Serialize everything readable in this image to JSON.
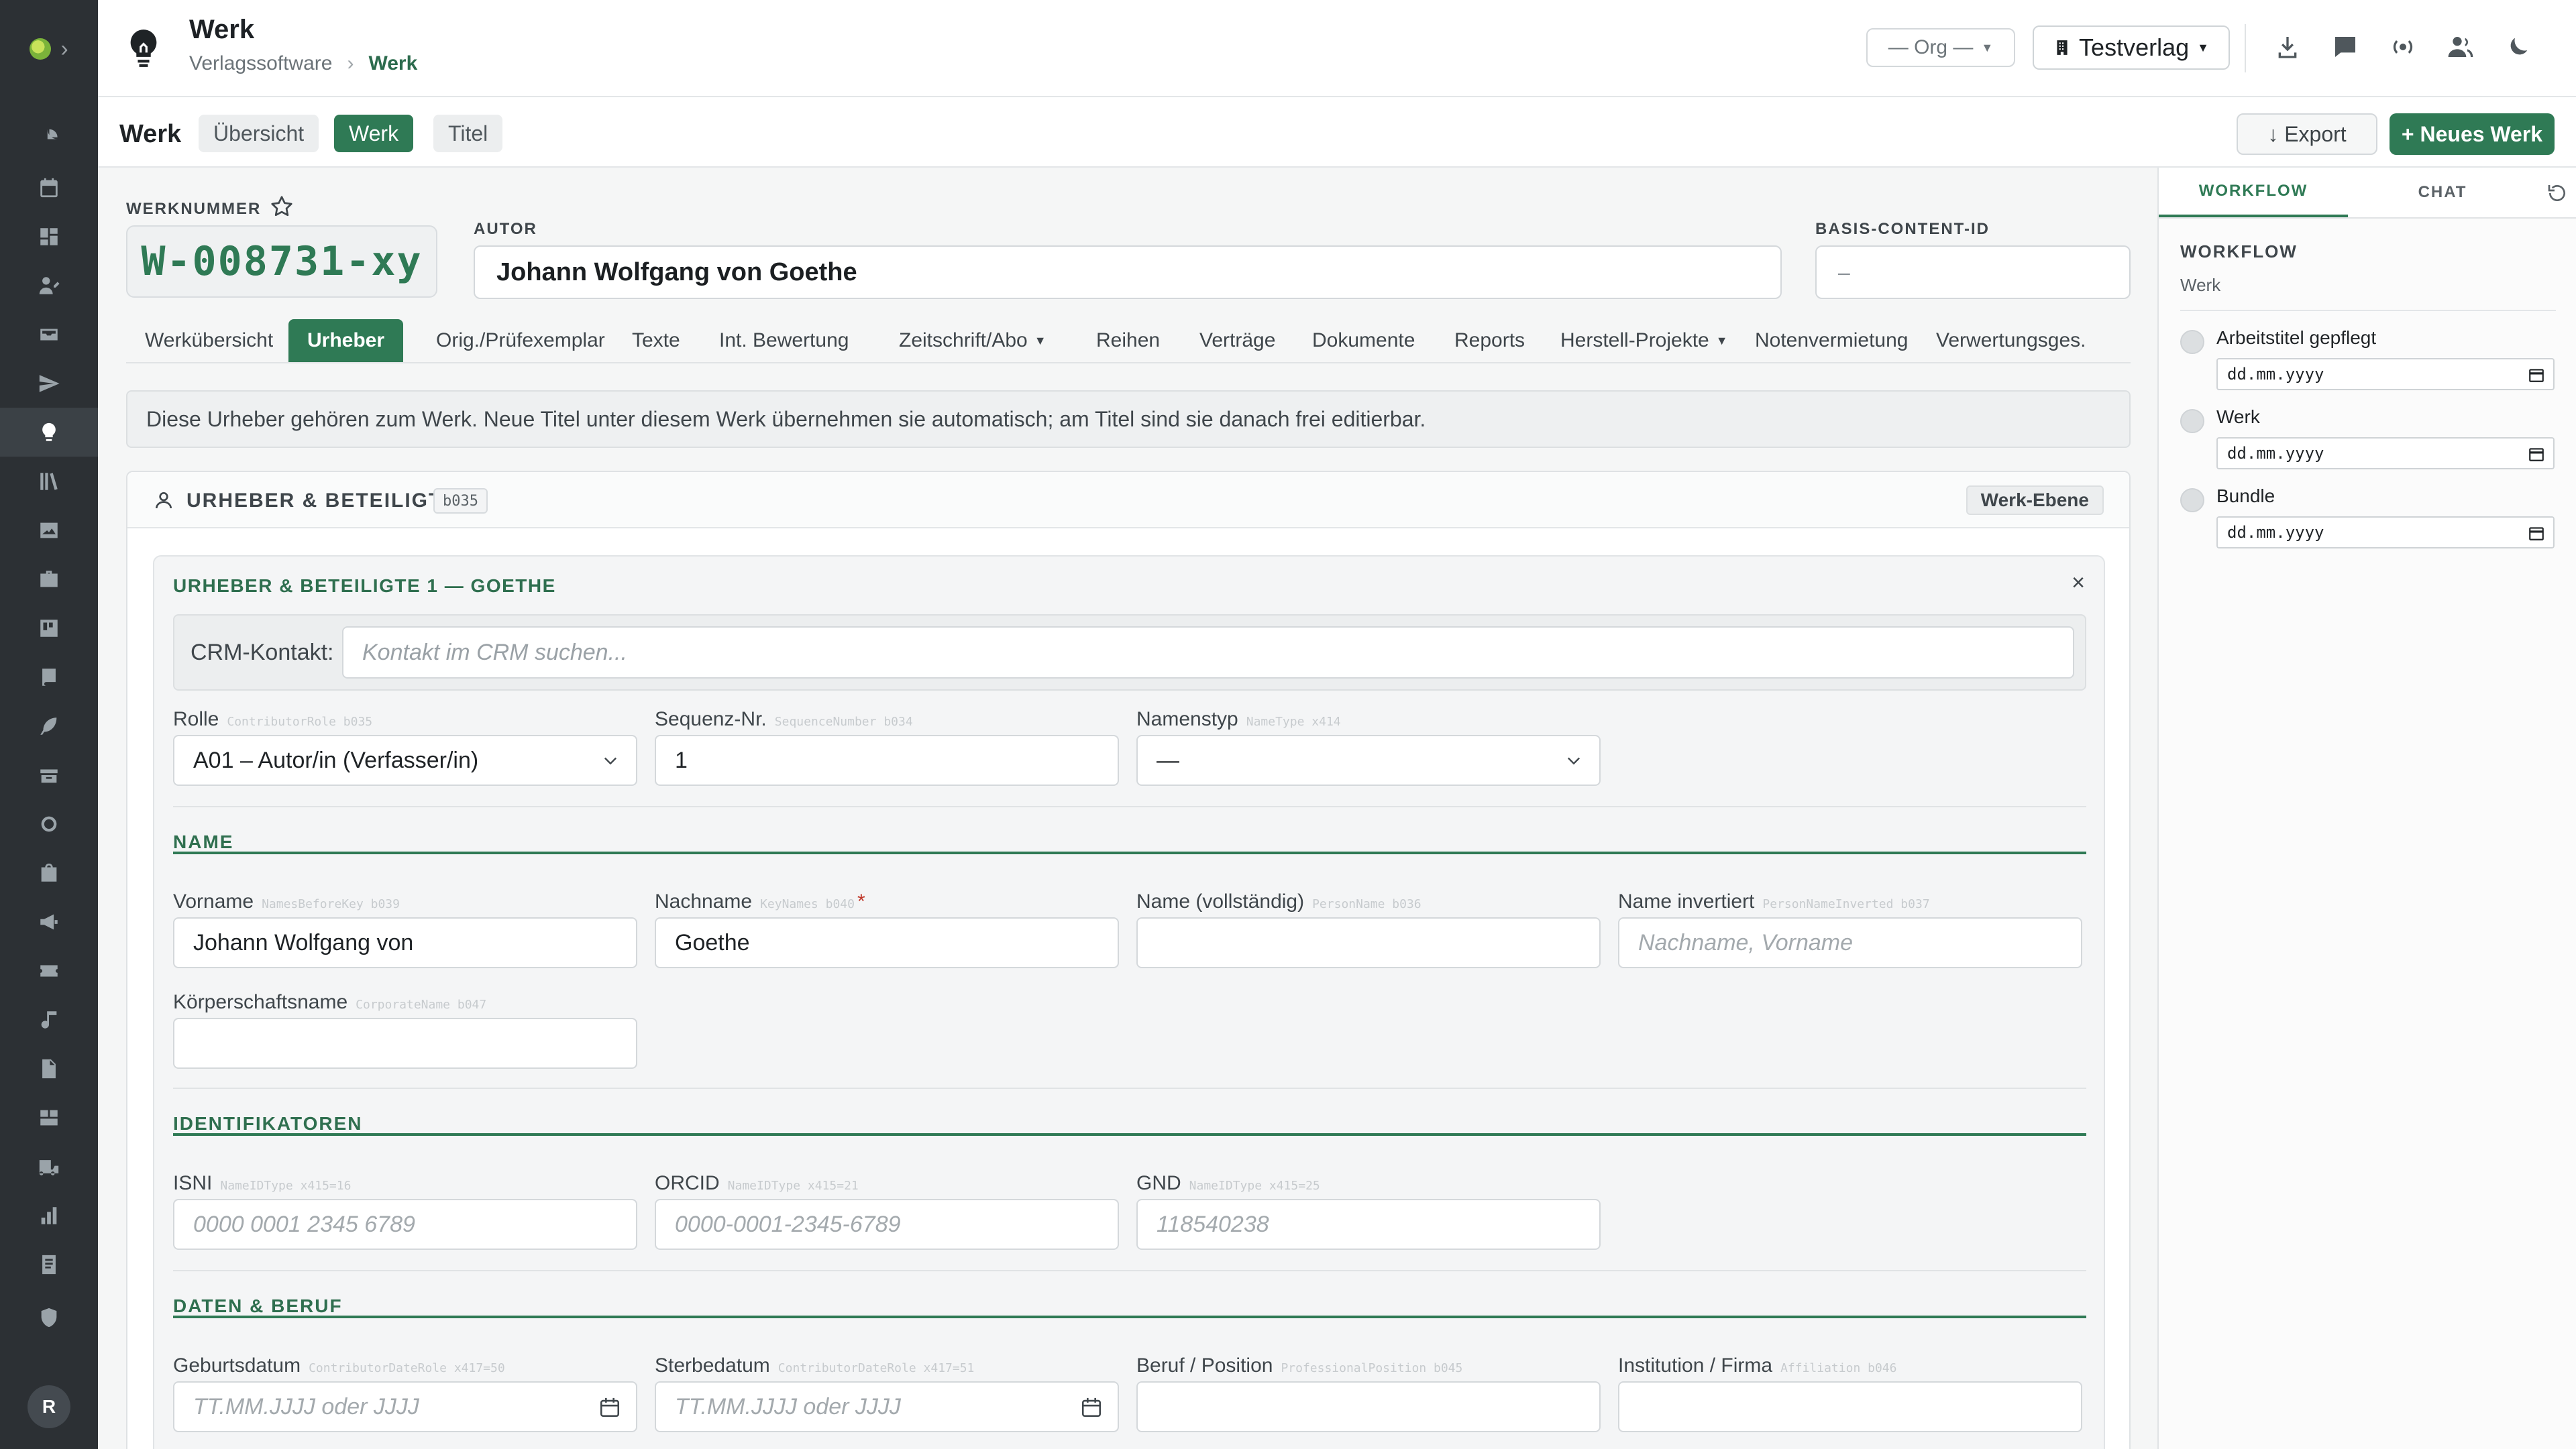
{
  "header": {
    "title": "Werk",
    "breadcrumb": [
      "Verlagssoftware",
      "Werk"
    ],
    "org_select": "— Org —",
    "publisher_select": "Testverlag"
  },
  "subheader": {
    "title": "Werk",
    "pills": [
      "Übersicht",
      "Werk",
      "Titel"
    ],
    "active_pill": "Werk",
    "export_label": "↓ Export",
    "new_label": "+ Neues Werk"
  },
  "work": {
    "werknummer_label": "WERKNUMMER",
    "werknummer": "W-008731-xy",
    "autor_label": "AUTOR",
    "autor": "Johann Wolfgang von Goethe",
    "basis_label": "BASIS-CONTENT-ID",
    "basis": "–"
  },
  "tabs": [
    "Werkübersicht",
    "Urheber",
    "Orig./Prüfexemplar",
    "Texte",
    "Int. Bewertung",
    "Zeitschrift/Abo",
    "Reihen",
    "Verträge",
    "Dokumente",
    "Reports",
    "Herstell-Projekte",
    "Notenvermietung",
    "Verwertungsges."
  ],
  "active_tab": "Urheber",
  "info_text": "Diese Urheber gehören zum Werk. Neue Titel unter diesem Werk übernehmen sie automatisch; am Titel sind sie danach frei editierbar.",
  "section": {
    "title": "URHEBER & BETEILIGTE",
    "code": "b035",
    "level": "Werk-Ebene"
  },
  "card": {
    "title": "URHEBER & BETEILIGTE 1 — GOETHE",
    "close": "×",
    "crm_label": "CRM-Kontakt:",
    "crm_placeholder": "Kontakt im CRM suchen..."
  },
  "fields": {
    "rolle": {
      "label": "Rolle",
      "hint": "ContributorRole b035",
      "value": "A01 – Autor/in (Verfasser/in)"
    },
    "sequenz": {
      "label": "Sequenz-Nr.",
      "hint": "SequenceNumber b034",
      "value": "1"
    },
    "namenstyp": {
      "label": "Namenstyp",
      "hint": "NameType x414",
      "value": "—"
    },
    "vorname": {
      "label": "Vorname",
      "hint": "NamesBeforeKey b039",
      "value": "Johann Wolfgang von"
    },
    "nachname": {
      "label": "Nachname",
      "hint": "KeyNames b040",
      "required": "*",
      "value": "Goethe"
    },
    "name_voll": {
      "label": "Name (vollständig)",
      "hint": "PersonName b036",
      "value": ""
    },
    "name_inv": {
      "label": "Name invertiert",
      "hint": "PersonNameInverted b037",
      "placeholder": "Nachname, Vorname"
    },
    "koerperschaft": {
      "label": "Körperschaftsname",
      "hint": "CorporateName b047",
      "value": ""
    },
    "isni": {
      "label": "ISNI",
      "hint": "NameIDType x415=16",
      "placeholder": "0000 0001 2345 6789"
    },
    "orcid": {
      "label": "ORCID",
      "hint": "NameIDType x415=21",
      "placeholder": "0000-0001-2345-6789"
    },
    "gnd": {
      "label": "GND",
      "hint": "NameIDType x415=25",
      "placeholder": "118540238"
    },
    "geburt": {
      "label": "Geburtsdatum",
      "hint": "ContributorDateRole x417=50",
      "placeholder": "TT.MM.JJJJ oder JJJJ"
    },
    "sterbe": {
      "label": "Sterbedatum",
      "hint": "ContributorDateRole x417=51",
      "placeholder": "TT.MM.JJJJ oder JJJJ"
    },
    "beruf": {
      "label": "Beruf / Position",
      "hint": "ProfessionalPosition b045",
      "value": ""
    },
    "institution": {
      "label": "Institution / Firma",
      "hint": "Affiliation b046",
      "value": ""
    }
  },
  "groups": {
    "name": "NAME",
    "ids": "IDENTIFIKATOREN",
    "daten": "DATEN & BERUF"
  },
  "right_panel": {
    "tabs": [
      "WORKFLOW",
      "CHAT"
    ],
    "active_tab": "WORKFLOW",
    "caption": "WORKFLOW",
    "subtitle": "Werk",
    "steps": [
      {
        "label": "Arbeitstitel gepflegt",
        "date": "dd.mm.yyyy"
      },
      {
        "label": "Werk",
        "date": "dd.mm.yyyy"
      },
      {
        "label": "Bundle",
        "date": "dd.mm.yyyy"
      }
    ]
  },
  "user": {
    "initial": "R"
  },
  "colors": {
    "accent": "#2f7a55",
    "sidebar": "#2c3034"
  }
}
